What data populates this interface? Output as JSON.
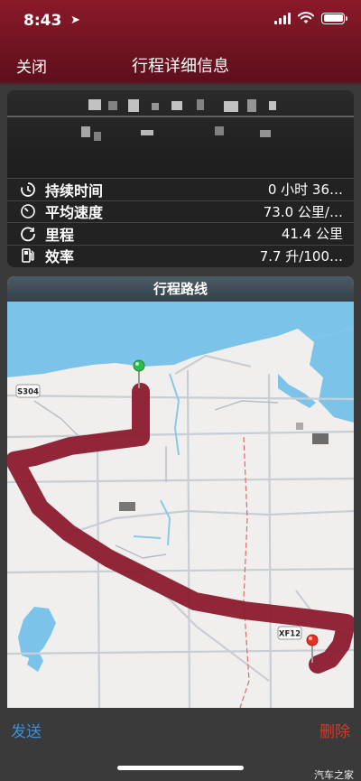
{
  "status": {
    "time": "8:43"
  },
  "nav": {
    "close_label": "关闭",
    "title": "行程详细信息"
  },
  "stats": [
    {
      "icon": "duration-icon",
      "label": "持续时间",
      "value": "0 小时 36…"
    },
    {
      "icon": "speedometer-icon",
      "label": "平均速度",
      "value": "73.0 公里/…"
    },
    {
      "icon": "odometer-icon",
      "label": "里程",
      "value": "41.4 公里"
    },
    {
      "icon": "fuel-pump-icon",
      "label": "效率",
      "value": "7.7 升/100…"
    }
  ],
  "route": {
    "title": "行程路线",
    "road_labels": [
      "S304",
      "XF12"
    ],
    "route_color": "#8b1a2e",
    "start_pin_color": "#2dbb4a",
    "end_pin_color": "#e53225"
  },
  "bottom": {
    "send_label": "发送",
    "delete_label": "删除",
    "watermark": "汽车之家"
  },
  "colors": {
    "accent": "#3d8fd8",
    "danger": "#d23b2a",
    "header": "#7a1624"
  }
}
